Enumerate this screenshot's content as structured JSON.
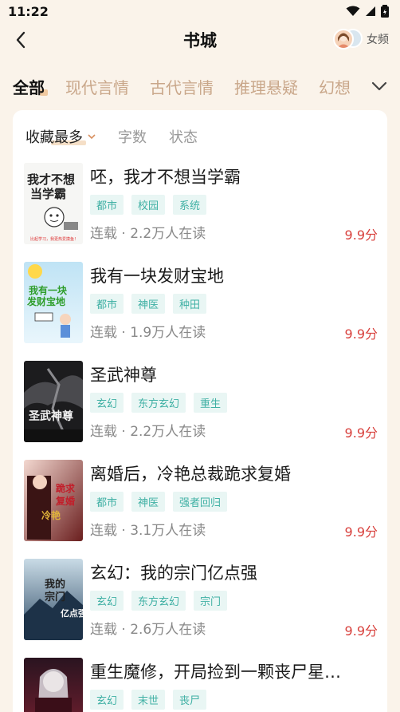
{
  "status": {
    "time": "11:22"
  },
  "header": {
    "title": "书城",
    "gender_label": "女频"
  },
  "tabs": [
    "全部",
    "现代言情",
    "古代言情",
    "推理悬疑",
    "幻想"
  ],
  "filters": [
    "收藏最多",
    "字数",
    "状态"
  ],
  "books": [
    {
      "title": "呸，我才不想当学霸",
      "tags": [
        "都市",
        "校园",
        "系统"
      ],
      "meta": "连载 · 2.2万人在读",
      "score": "9.9分",
      "cover_text": "我才不想当学霸"
    },
    {
      "title": "我有一块发财宝地",
      "tags": [
        "都市",
        "神医",
        "种田"
      ],
      "meta": "连载 · 1.9万人在读",
      "score": "9.9分",
      "cover_text": "我有一块发财宝地"
    },
    {
      "title": "圣武神尊",
      "tags": [
        "玄幻",
        "东方玄幻",
        "重生"
      ],
      "meta": "连载 · 2.2万人在读",
      "score": "9.9分",
      "cover_text": "圣武神尊"
    },
    {
      "title": "离婚后，冷艳总裁跪求复婚",
      "tags": [
        "都市",
        "神医",
        "强者回归"
      ],
      "meta": "连载 · 3.1万人在读",
      "score": "9.9分",
      "cover_text": "冷艳总裁跪求复婚"
    },
    {
      "title": "玄幻：我的宗门亿点强",
      "tags": [
        "玄幻",
        "东方玄幻",
        "宗门"
      ],
      "meta": "连载 · 2.6万人在读",
      "score": "9.9分",
      "cover_text": "我的宗门亿点强"
    },
    {
      "title": "重生魔修，开局捡到一颗丧尸星…",
      "tags": [
        "玄幻",
        "末世",
        "丧尸"
      ],
      "meta": "",
      "score": "",
      "cover_text": ""
    }
  ],
  "colors": {
    "accent_tag": "#3fb0a4",
    "score": "#d8403c",
    "tab_inactive": "#c9a78a",
    "background": "#faf3ea"
  }
}
